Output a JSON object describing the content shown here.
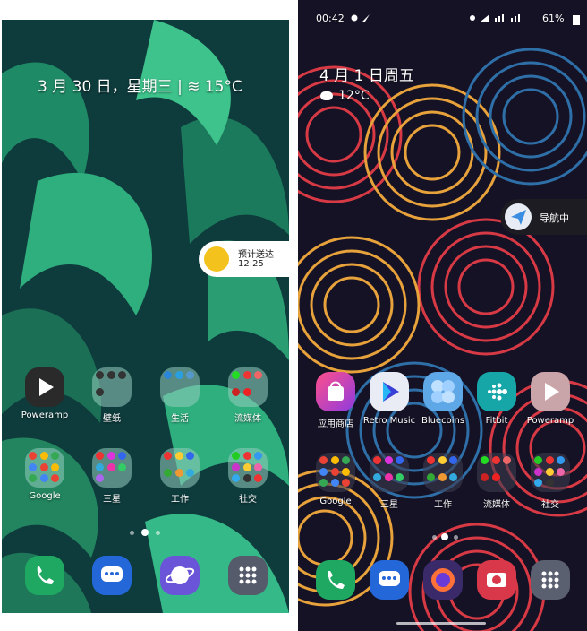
{
  "left": {
    "date_weather": "3 月 30 日，星期三 | ≋ 15°C",
    "delivery": {
      "title": "预计送达",
      "time": "12:25"
    },
    "apps": [
      {
        "label": "Poweramp"
      },
      {
        "label": "壁纸"
      },
      {
        "label": "生活"
      },
      {
        "label": "流媒体"
      },
      {
        "label": "Google"
      },
      {
        "label": "三星"
      },
      {
        "label": "工作"
      },
      {
        "label": "社交"
      }
    ]
  },
  "right": {
    "status": {
      "time": "00:42",
      "battery": "61%"
    },
    "date": "4 月 1 日周五",
    "weather": "12°C",
    "nav_pill": "导航中",
    "apps": [
      {
        "label": "应用商店"
      },
      {
        "label": "Retro Music"
      },
      {
        "label": "Bluecoins"
      },
      {
        "label": "Fitbit"
      },
      {
        "label": "Poweramp"
      },
      {
        "label": "Google"
      },
      {
        "label": "三星"
      },
      {
        "label": "工作"
      },
      {
        "label": "流媒体"
      },
      {
        "label": "社交"
      }
    ]
  },
  "colors": {
    "leaf_dark": "#0e3b3c",
    "leaf_green": "#2fae7e",
    "arc_red": "#d83a45",
    "arc_orange": "#e8a23b",
    "arc_blue": "#2f6fa8"
  }
}
